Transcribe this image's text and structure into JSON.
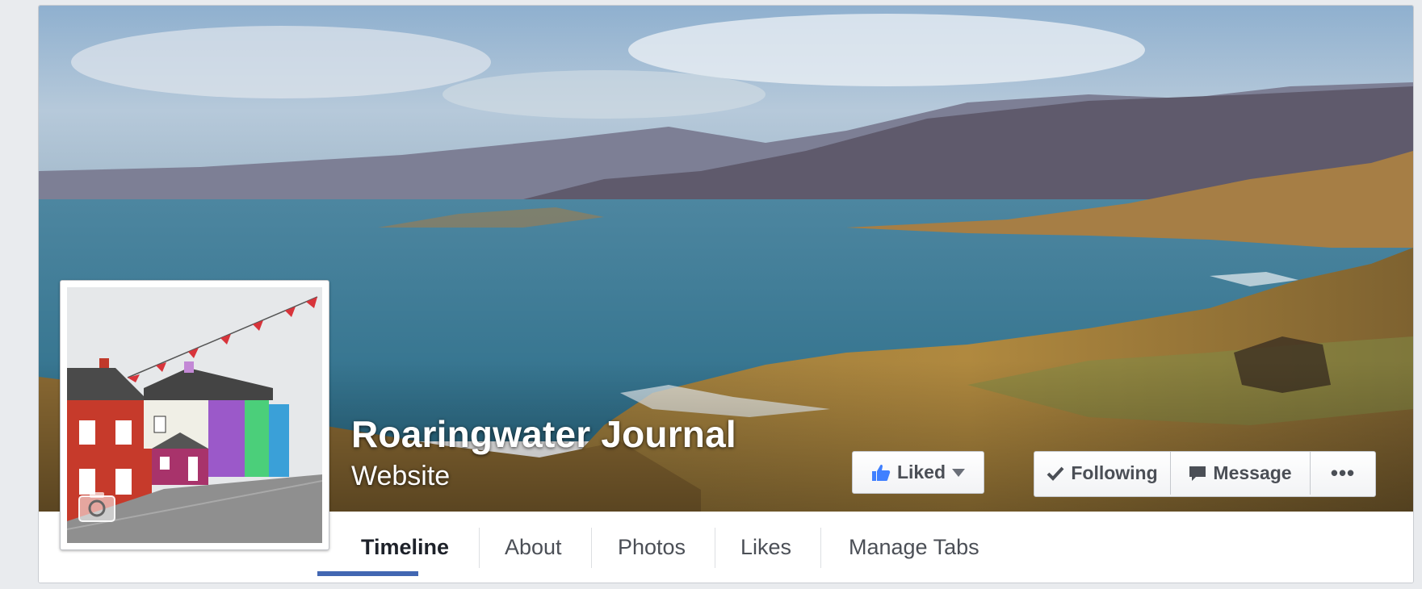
{
  "page": {
    "name": "Roaringwater Journal",
    "category": "Website"
  },
  "actions": {
    "liked_label": "Liked",
    "following_label": "Following",
    "message_label": "Message",
    "more_label": "•••"
  },
  "tabs": [
    {
      "label": "Timeline",
      "active": true
    },
    {
      "label": "About",
      "active": false
    },
    {
      "label": "Photos",
      "active": false
    },
    {
      "label": "Likes",
      "active": false
    },
    {
      "label": "Manage Tabs",
      "active": false
    }
  ],
  "icons": {
    "liked": "thumbs-up-icon",
    "dropdown": "caret-down-icon",
    "following": "checkmark-icon",
    "message": "speech-bubble-icon",
    "more": "ellipsis-icon",
    "profile_camera": "camera-icon"
  },
  "colors": {
    "accent": "#4267b2",
    "like_icon": "#4080ff"
  }
}
